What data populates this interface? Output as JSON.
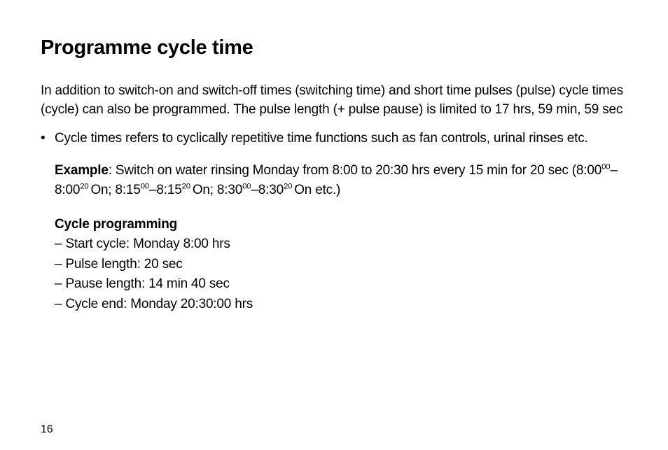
{
  "title": "Programme cycle time",
  "intro": "In addition to switch-on and switch-off times (switching time) and short time pulses (pulse) cycle times (cycle) can also be programmed. The pulse length (+ pulse pause) is limited to 17 hrs, 59 min, 59 sec",
  "bullet1": "Cycle times refers to cyclically repetitive time functions such as fan controls, urinal rinses etc.",
  "example": {
    "label": "Example",
    "text_before": ": Switch on water rinsing Monday from 8:00 to 20:30 hrs every 15 min for 20 sec (8:00",
    "sup1": "00",
    "seg2": "–8:00",
    "sup2": "20 ",
    "seg3": "On; 8:15",
    "sup3": "00",
    "seg4": "–8:15",
    "sup4": "20 ",
    "seg5": "On; 8:30",
    "sup5": "00",
    "seg6": "–8:30",
    "sup6": "20 ",
    "seg7": "On etc.)"
  },
  "cycle": {
    "heading": "Cycle programming",
    "line1": "– Start cycle: Monday 8:00 hrs",
    "line2": "– Pulse length: 20 sec",
    "line3": "– Pause length: 14 min 40 sec",
    "line4": "– Cycle end: Monday 20:30:00 hrs"
  },
  "page_number": "16"
}
